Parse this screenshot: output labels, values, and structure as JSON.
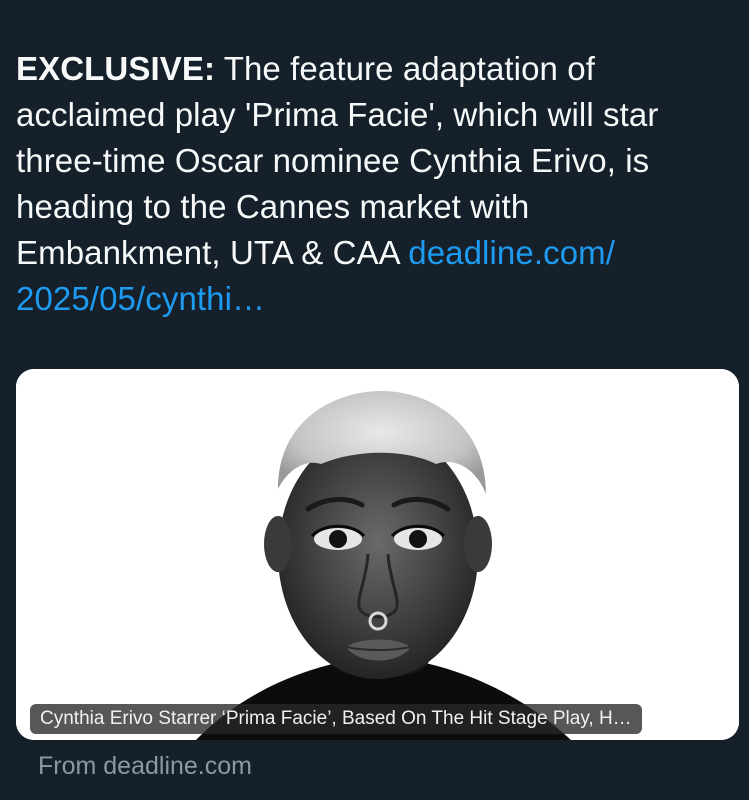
{
  "tweet": {
    "lead": "EXCLUSIVE:",
    "body": " The feature adaptation of acclaimed play 'Prima Facie', which will star three-time Oscar nominee Cynthia Erivo, is heading to the Cannes market with Embankment, UTA & CAA ",
    "link_line1": "deadline.com/",
    "link_line2": "2025/05/cynthi…"
  },
  "card": {
    "caption": "Cynthia Erivo Starrer ‘Prima Facie’, Based On The Hit Stage Play, H…",
    "image_subject": "black-and-white portrait of a woman with short platinum hair and a nose ring"
  },
  "source": {
    "label": "From deadline.com"
  },
  "colors": {
    "background": "#15202b",
    "text": "#f7f9f9",
    "link": "#1d9bf0",
    "muted": "#8b98a5"
  }
}
